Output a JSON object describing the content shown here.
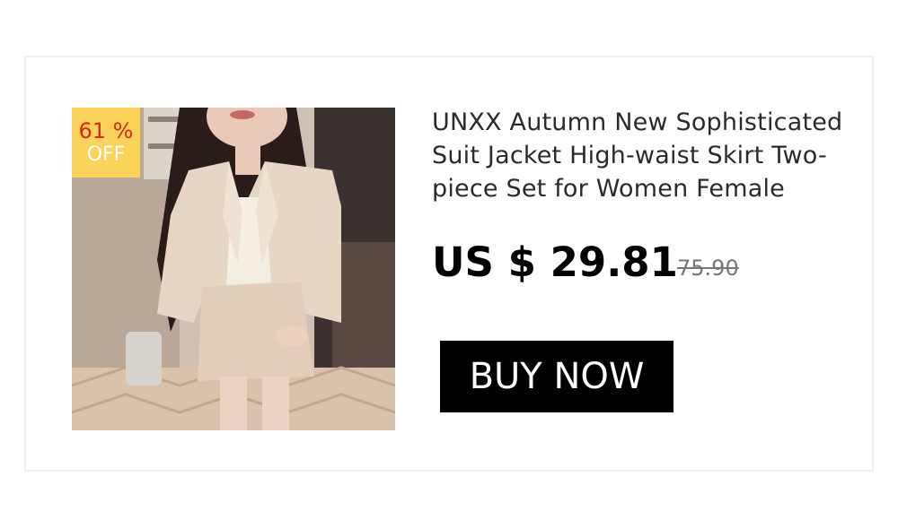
{
  "product": {
    "title": "UNXX Autumn New Sophisticated Suit Jacket High-waist Skirt Two-piece Set for Women Female",
    "image_icon": "product-photo-woman-beige-suit",
    "discount": {
      "percent": "61 %",
      "label": "OFF",
      "badge_color": "#fbd25a",
      "percent_color": "#d8281d"
    },
    "price": "US $ 29.81",
    "original_price": "75.90",
    "buy_label": "BUY NOW",
    "button_color": "#000000"
  }
}
